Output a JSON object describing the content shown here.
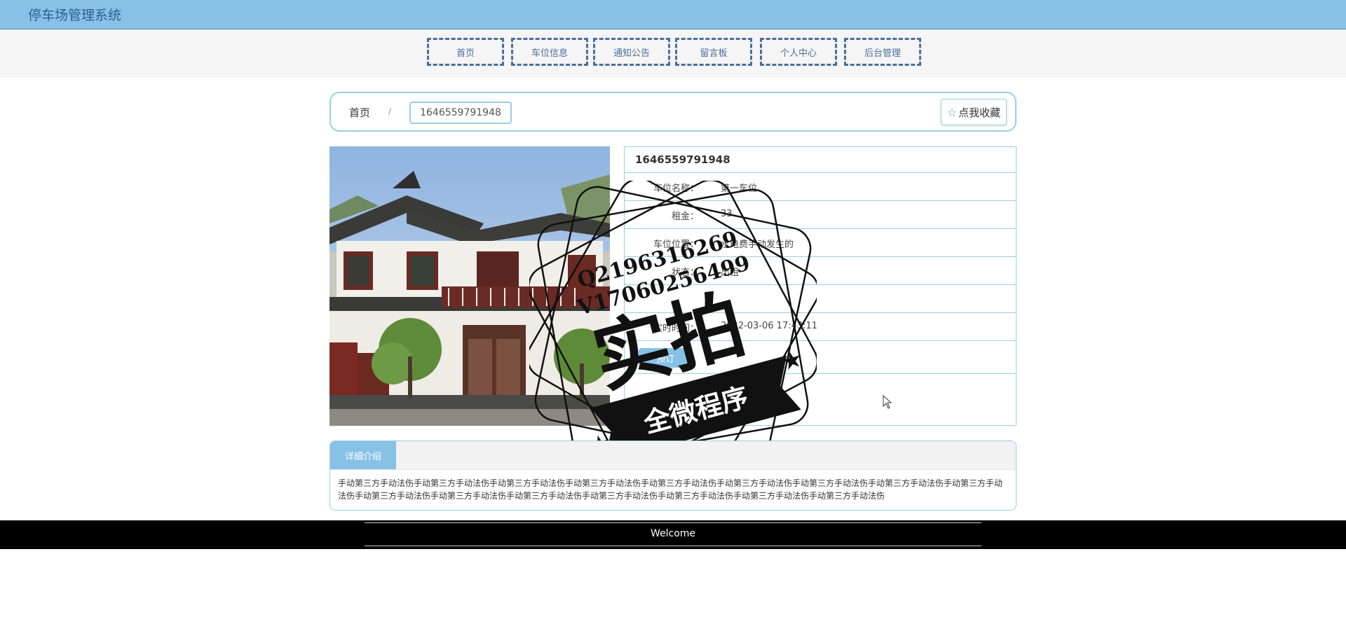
{
  "app": {
    "title": "停车场管理系统"
  },
  "nav": [
    {
      "label": "首页"
    },
    {
      "label": "车位信息"
    },
    {
      "label": "通知公告"
    },
    {
      "label": "留言板"
    },
    {
      "label": "个人中心"
    },
    {
      "label": "后台管理"
    }
  ],
  "breadcrumb": {
    "home": "首页",
    "separator": "/",
    "current": "1646559791948"
  },
  "favorite": {
    "label": "点我收藏"
  },
  "detail": {
    "title": "1646559791948",
    "rows": [
      {
        "label": "车位名称：",
        "value": "第一车位"
      },
      {
        "label": "租金：",
        "value": "33"
      },
      {
        "label": "车位位置：",
        "value": "水电费手动发生的"
      },
      {
        "label": "状态：",
        "value": "出租"
      },
      {
        "label": "实时时间：",
        "value": "2022-03-06 17:43:11"
      }
    ],
    "book_button": "预订"
  },
  "watermark": {
    "lines": [
      "Q2196316269",
      "V17060256499"
    ],
    "main": "实拍",
    "banner": "全微程序"
  },
  "intro": {
    "tab": "详细介绍",
    "text": "手动第三方手动法伤手动第三方手动法伤手动第三方手动法伤手动第三方手动法伤手动第三方手动法伤手动第三方手动法伤手动第三方手动法伤手动第三方手动法伤手动第三方手动法伤手动第三方手动法伤手动第三方手动法伤手动第三方手动法伤手动第三方手动法伤手动第三方手动法伤手动第三方手动法伤手动第三方手动法伤"
  },
  "footer": {
    "text": "Welcome"
  },
  "colors": {
    "primary": "#87c2e6",
    "border": "#9acfe0",
    "nav": "#4b6e9c"
  }
}
